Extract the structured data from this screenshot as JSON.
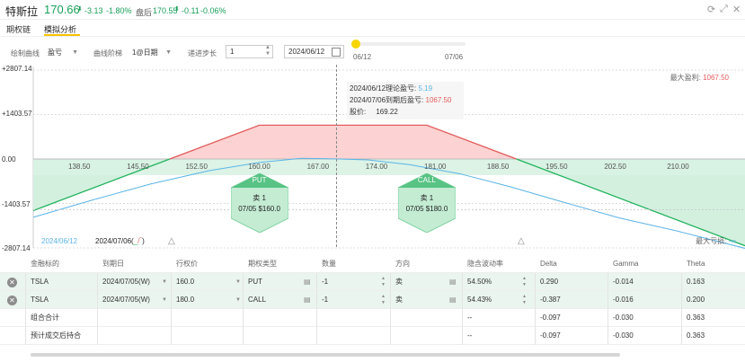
{
  "header": {
    "title": "特斯拉",
    "price": "170.66",
    "change": "-3.13",
    "change_pct": "-1.80%",
    "after_hours_label": "盘后",
    "after_hours_price": "170.55",
    "after_hours_change": "-0.11",
    "after_hours_change_pct": "-0.06%"
  },
  "tabs": [
    {
      "label": "期权链",
      "active": false
    },
    {
      "label": "模拟分析",
      "active": true
    }
  ],
  "toolbar": {
    "curve_label": "绘制曲线",
    "curve_value": "盈亏",
    "ladder_label": "曲线阶梯",
    "ladder_value": "1@日期",
    "step_label": "递进步长",
    "step_value": "1",
    "date_value": "2024/06/12",
    "slider_start": "06/12",
    "slider_end": "07/06",
    "slider_position": 0
  },
  "chart_data": {
    "type": "line",
    "xlabel": "",
    "ylabel": "",
    "x_ticks": [
      "138.50",
      "145.50",
      "152.50",
      "160.00",
      "167.00",
      "174.00",
      "181.00",
      "188.50",
      "195.50",
      "202.50",
      "210.00"
    ],
    "y_ticks": [
      "+2807.14",
      "+1403.57",
      "0.00",
      "-1403.57",
      "-2807.14"
    ],
    "xlim": [
      133,
      218
    ],
    "ylim": [
      -2807.14,
      2807.14
    ],
    "current_price": 169.22,
    "series": [
      {
        "name": "2024/06/12",
        "color": "#5ab4e8",
        "x": [
          133,
          140,
          147,
          154,
          160,
          165,
          169,
          173,
          178,
          184,
          190,
          196,
          203,
          210,
          218
        ],
        "y": [
          -1840,
          -1300,
          -790,
          -370,
          -110,
          20,
          5,
          -30,
          -180,
          -470,
          -880,
          -1340,
          -1860,
          -2280,
          -2820
        ]
      },
      {
        "name": "2024/07/06",
        "color": "#22b35e",
        "x": [
          133,
          149.3,
          160,
          180,
          190.7,
          218
        ],
        "y": [
          -1630,
          0,
          1067.5,
          1067.5,
          0,
          -2740
        ]
      }
    ],
    "legend": [
      {
        "label": "2024/06/12",
        "color": "#5ab4e8"
      },
      {
        "label": "2024/07/06",
        "color": "#222"
      }
    ],
    "max_profit_label": "最大盈利:",
    "max_profit_value": "1067.50",
    "max_loss_label": "最大亏损:",
    "max_loss_value": "-∞",
    "tooltip": {
      "line1_label": "2024/06/12理论盈亏:",
      "line1_value": "5.19",
      "line2_label": "2024/07/06到期后盈亏:",
      "line2_value": "1067.50",
      "line3_label": "股价:",
      "line3_value": "169.22"
    },
    "markers": [
      {
        "type": "PUT",
        "action": "卖 1",
        "detail": "07/05 $160.0",
        "strike": 160.0
      },
      {
        "type": "CALL",
        "action": "卖 1",
        "detail": "07/05 $180.0",
        "strike": 180.0
      }
    ]
  },
  "table": {
    "headers": [
      "金融标的",
      "到期日",
      "行权价",
      "期权类型",
      "数量",
      "方向",
      "隐含波动率",
      "Delta",
      "Gamma",
      "Theta"
    ],
    "rows": [
      [
        "TSLA",
        "2024/07/05(W)",
        "160.0",
        "PUT",
        "-1",
        "卖",
        "54.50%",
        "0.290",
        "-0.014",
        "0.163"
      ],
      [
        "TSLA",
        "2024/07/05(W)",
        "180.0",
        "CALL",
        "-1",
        "卖",
        "54.43%",
        "-0.387",
        "-0.016",
        "0.200"
      ]
    ],
    "summary_rows": [
      {
        "label": "组合合计",
        "iv": "--",
        "delta": "-0.097",
        "gamma": "-0.030",
        "theta": "0.363"
      },
      {
        "label": "预计成交后持合",
        "iv": "--",
        "delta": "-0.097",
        "gamma": "-0.030",
        "theta": "0.363"
      }
    ]
  },
  "colors": {
    "up_green": "#19a05a",
    "loss_red": "#e25b5b",
    "accent_yellow": "#f6c400",
    "profit_fill": "#fcd2d2",
    "loss_fill": "#d3f0df"
  }
}
